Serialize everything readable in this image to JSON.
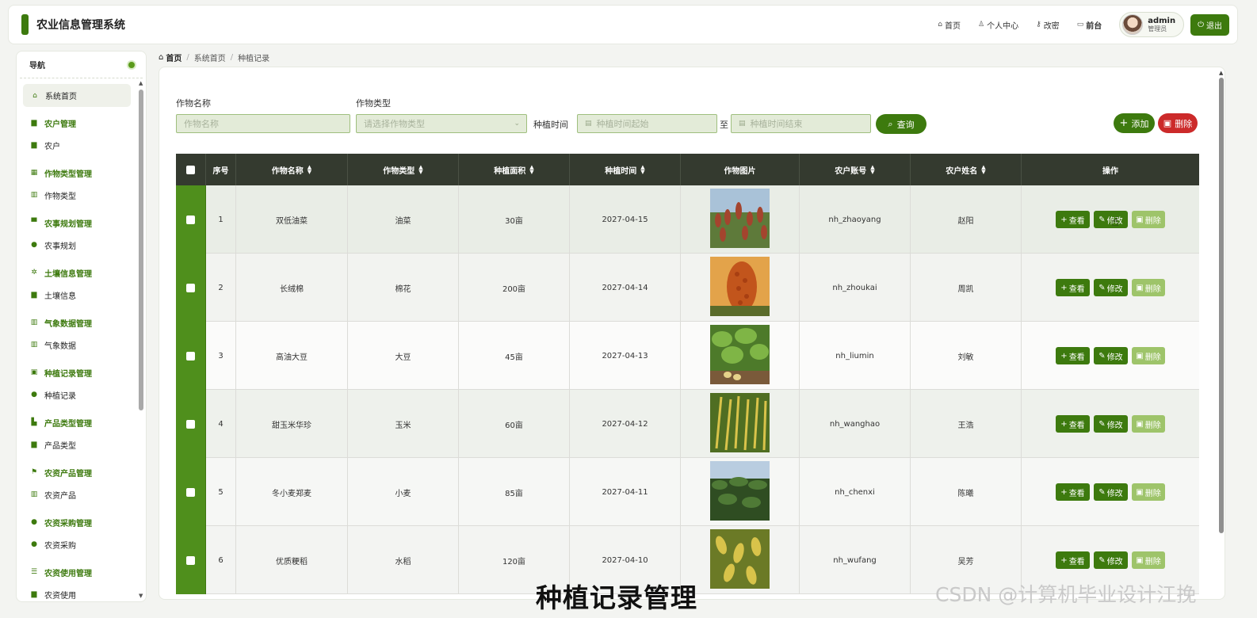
{
  "app": {
    "title": "农业信息管理系统"
  },
  "topnav": {
    "items": [
      {
        "icon": "home-icon",
        "label": "首页"
      },
      {
        "icon": "user-icon",
        "label": "个人中心"
      },
      {
        "icon": "key-icon",
        "label": "改密"
      },
      {
        "icon": "monitor-icon",
        "label": "前台"
      }
    ],
    "user": {
      "name": "admin",
      "role": "管理员"
    },
    "logout": "退出"
  },
  "sidebar": {
    "title": "导航",
    "home": "系统首页",
    "groups": [
      {
        "title": "农户管理",
        "item": "农户"
      },
      {
        "title": "作物类型管理",
        "item": "作物类型"
      },
      {
        "title": "农事规划管理",
        "item": "农事规划"
      },
      {
        "title": "土壤信息管理",
        "item": "土壤信息"
      },
      {
        "title": "气象数据管理",
        "item": "气象数据"
      },
      {
        "title": "种植记录管理",
        "item": "种植记录"
      },
      {
        "title": "产品类型管理",
        "item": "产品类型"
      },
      {
        "title": "农资产品管理",
        "item": "农资产品"
      },
      {
        "title": "农资采购管理",
        "item": "农资采购"
      },
      {
        "title": "农资使用管理",
        "item": "农资使用"
      }
    ]
  },
  "breadcrumb": {
    "home": "首页",
    "level1": "系统首页",
    "level2": "种植记录"
  },
  "filters": {
    "name_label": "作物名称",
    "name_placeholder": "作物名称",
    "type_label": "作物类型",
    "type_placeholder": "请选择作物类型",
    "time_label": "种植时间",
    "start_placeholder": "种植时间起始",
    "to": "至",
    "end_placeholder": "种植时间结束",
    "query": "查询",
    "add": "添加",
    "delete": "删除"
  },
  "table": {
    "headers": {
      "seq": "序号",
      "name": "作物名称",
      "type": "作物类型",
      "area": "种植面积",
      "time": "种植时间",
      "photo": "作物图片",
      "account": "农户账号",
      "farmer": "农户姓名",
      "ops": "操作"
    },
    "actions": {
      "view": "查看",
      "edit": "修改",
      "del": "删除"
    },
    "rows": [
      {
        "seq": "1",
        "name": "双低油菜",
        "type": "油菜",
        "area": "30亩",
        "time": "2027-04-15",
        "account": "nh_zhaoyang",
        "farmer": "赵阳"
      },
      {
        "seq": "2",
        "name": "长绒棉",
        "type": "棉花",
        "area": "200亩",
        "time": "2027-04-14",
        "account": "nh_zhoukai",
        "farmer": "周凯"
      },
      {
        "seq": "3",
        "name": "高油大豆",
        "type": "大豆",
        "area": "45亩",
        "time": "2027-04-13",
        "account": "nh_liumin",
        "farmer": "刘敏"
      },
      {
        "seq": "4",
        "name": "甜玉米华珍",
        "type": "玉米",
        "area": "60亩",
        "time": "2027-04-12",
        "account": "nh_wanghao",
        "farmer": "王浩"
      },
      {
        "seq": "5",
        "name": "冬小麦郑麦",
        "type": "小麦",
        "area": "85亩",
        "time": "2027-04-11",
        "account": "nh_chenxi",
        "farmer": "陈曦"
      },
      {
        "seq": "6",
        "name": "优质粳稻",
        "type": "水稻",
        "area": "120亩",
        "time": "2027-04-10",
        "account": "nh_wufang",
        "farmer": "吴芳"
      }
    ]
  },
  "overlay": {
    "caption": "种植记录管理",
    "watermark": "CSDN @计算机毕业设计江挽"
  },
  "colors": {
    "primary": "#3d7a0e",
    "danger": "#cc2a2a",
    "header": "#343a2f",
    "input_bg": "#e3ebd8"
  }
}
